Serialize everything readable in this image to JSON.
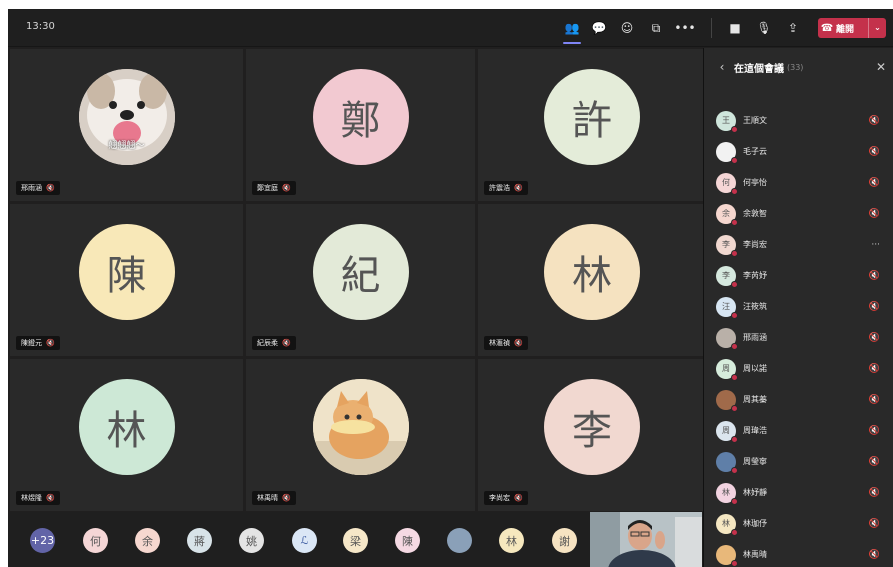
{
  "topbar": {
    "time": "13:30",
    "buttons": [
      {
        "name": "people-icon",
        "glyph": "👥",
        "active": true
      },
      {
        "name": "chat-icon",
        "glyph": "💬",
        "active": false
      },
      {
        "name": "react-icon",
        "glyph": "☺",
        "active": false
      },
      {
        "name": "share-tray-icon",
        "glyph": "⧉",
        "active": false
      },
      {
        "name": "more-icon",
        "glyph": "•••",
        "active": false
      }
    ],
    "controls": [
      {
        "name": "camera-icon",
        "glyph": "■"
      },
      {
        "name": "mic-icon",
        "glyph": "🎙"
      },
      {
        "name": "share-screen-icon",
        "glyph": "⇪"
      }
    ],
    "leave_label": "離開",
    "leave_phone_icon": "☎",
    "leave_dropdown_icon": "⌄"
  },
  "tiles": [
    {
      "name": "邢雨涵",
      "initial": "",
      "bg": "#ddd4cc",
      "image": "dog",
      "caption": "翹翹翹～"
    },
    {
      "name": "鄭宜庭",
      "initial": "鄭",
      "bg": "#f2c9d1"
    },
    {
      "name": "許震浩",
      "initial": "許",
      "bg": "#e4ecd9"
    },
    {
      "name": "陳鐙元",
      "initial": "陳",
      "bg": "#f8e8b8"
    },
    {
      "name": "紀辰柔",
      "initial": "紀",
      "bg": "#e3ead8"
    },
    {
      "name": "林滙禎",
      "initial": "林",
      "bg": "#f5e2c0"
    },
    {
      "name": "林煜隆",
      "initial": "林",
      "bg": "#cde8d6"
    },
    {
      "name": "林禹晴",
      "initial": "",
      "bg": "#f0e4c8",
      "image": "cat"
    },
    {
      "name": "李尚宏",
      "initial": "李",
      "bg": "#f1d8d0"
    }
  ],
  "bottom_avatars": [
    {
      "label": "+23",
      "bg": "#6264a7",
      "color": "#ffffff"
    },
    {
      "label": "何",
      "bg": "#f5d6d6",
      "color": "#555555"
    },
    {
      "label": "余",
      "bg": "#f6d7cf",
      "color": "#555555"
    },
    {
      "label": "蔣",
      "bg": "#d8e3e8",
      "color": "#555555"
    },
    {
      "label": "姚",
      "bg": "#e4e4e4",
      "color": "#555555"
    },
    {
      "label": "ℒ",
      "bg": "#dbe7f6",
      "color": "#3b5aa0"
    },
    {
      "label": "梁",
      "bg": "#f6e7c8",
      "color": "#555555"
    },
    {
      "label": "陳",
      "bg": "#f5d9e3",
      "color": "#555555"
    },
    {
      "label": "",
      "bg": "#8aa0b8",
      "color": "#555555"
    },
    {
      "label": "林",
      "bg": "#f6e8be",
      "color": "#555555"
    },
    {
      "label": "謝",
      "bg": "#f6e3c2",
      "color": "#555555"
    }
  ],
  "panel": {
    "back_icon": "‹",
    "title": "在這個會議",
    "count": "(33)",
    "close_icon": "✕",
    "participants": [
      {
        "name": "王順文",
        "initial": "王",
        "bg": "#cfe6dc",
        "mic": "🔇"
      },
      {
        "name": "毛子云",
        "initial": "",
        "bg": "#f2f2f2",
        "mic": "🔇"
      },
      {
        "name": "何亭怡",
        "initial": "何",
        "bg": "#f5d6d6",
        "mic": "🔇"
      },
      {
        "name": "余敦智",
        "initial": "余",
        "bg": "#f6d7cf",
        "mic": "🔇"
      },
      {
        "name": "李尚宏",
        "initial": "李",
        "bg": "#f1d8d0",
        "mic": "···"
      },
      {
        "name": "李芮妤",
        "initial": "李",
        "bg": "#d5e8de",
        "mic": "🔇"
      },
      {
        "name": "汪筱筑",
        "initial": "汪",
        "bg": "#d7e6f3",
        "mic": "🔇"
      },
      {
        "name": "邢雨涵",
        "initial": "",
        "bg": "#b9b0a8",
        "mic": "🔇"
      },
      {
        "name": "周以諾",
        "initial": "周",
        "bg": "#d6ecdc",
        "mic": "🔇"
      },
      {
        "name": "周其蓁",
        "initial": "",
        "bg": "#a06a4a",
        "mic": "🔇"
      },
      {
        "name": "周瑋浩",
        "initial": "周",
        "bg": "#dbe5ee",
        "mic": "🔇"
      },
      {
        "name": "周瑩寧",
        "initial": "",
        "bg": "#5f7fa8",
        "mic": "🔇"
      },
      {
        "name": "林妤靜",
        "initial": "林",
        "bg": "#f2d3e0",
        "mic": "🔇"
      },
      {
        "name": "林珈伃",
        "initial": "林",
        "bg": "#f5e7c2",
        "mic": "🔇"
      },
      {
        "name": "林禹晴",
        "initial": "",
        "bg": "#e8b87a",
        "mic": "🔇"
      }
    ]
  },
  "mic_off_icon": "🔇"
}
